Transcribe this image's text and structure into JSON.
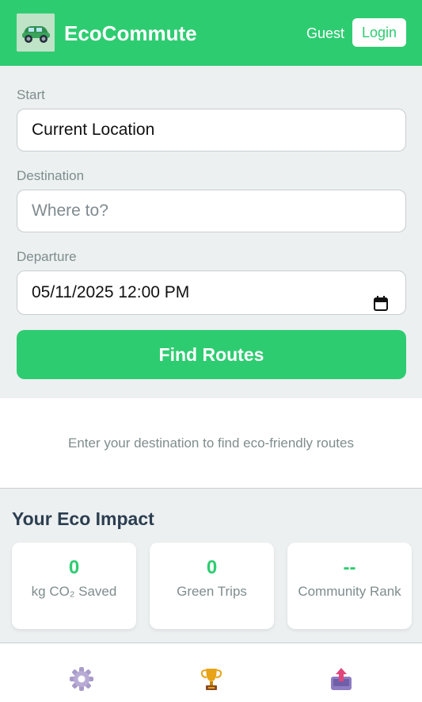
{
  "header": {
    "app_title": "EcoCommute",
    "user_label": "Guest",
    "login_label": "Login"
  },
  "form": {
    "start_label": "Start",
    "start_value": "Current Location",
    "destination_label": "Destination",
    "destination_placeholder": "Where to?",
    "departure_label": "Departure",
    "departure_value": "05/11/2025 12:00 PM",
    "find_button_label": "Find Routes"
  },
  "hint": "Enter your destination to find eco-friendly routes",
  "impact": {
    "title": "Your Eco Impact",
    "stats": [
      {
        "value": "0",
        "label": "kg CO₂ Saved"
      },
      {
        "value": "0",
        "label": "Green Trips"
      },
      {
        "value": "--",
        "label": "Community Rank"
      }
    ]
  },
  "nav": {
    "items": [
      {
        "icon": "gear-icon"
      },
      {
        "icon": "trophy-icon"
      },
      {
        "icon": "share-icon"
      }
    ]
  },
  "colors": {
    "primary": "#2ecc71",
    "panel": "#ecf0f1",
    "text_dark": "#2c3e50",
    "text_muted": "#7f8c8d"
  }
}
